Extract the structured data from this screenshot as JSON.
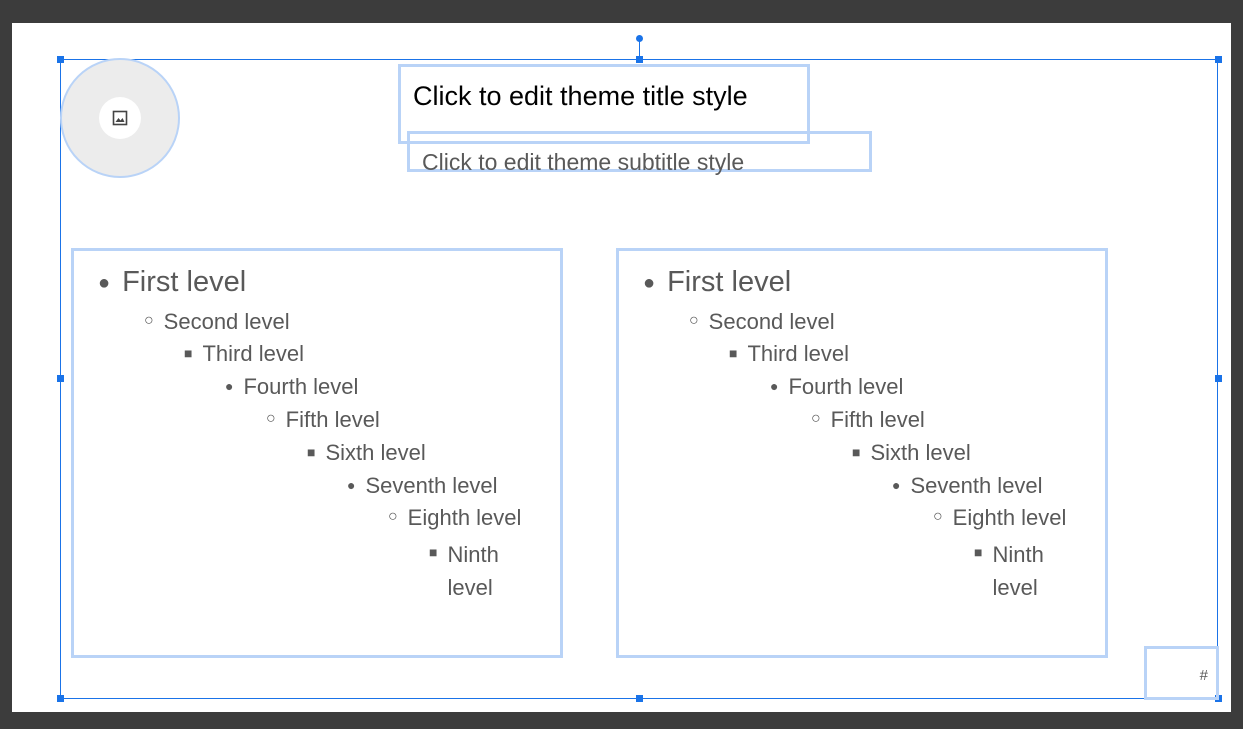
{
  "slide": {
    "title": "Click to edit theme title style",
    "subtitle": "Click to edit theme subtitle style",
    "image_icon": "image-icon",
    "slide_number": "#",
    "body_left": {
      "levels": [
        {
          "bullet": "●",
          "text": "First level"
        },
        {
          "bullet": "○",
          "text": "Second level"
        },
        {
          "bullet": "■",
          "text": "Third level"
        },
        {
          "bullet": "●",
          "text": "Fourth level"
        },
        {
          "bullet": "○",
          "text": "Fifth level"
        },
        {
          "bullet": "■",
          "text": "Sixth level"
        },
        {
          "bullet": "●",
          "text": "Seventh level"
        },
        {
          "bullet": "○",
          "text": "Eighth level"
        },
        {
          "bullet": "■",
          "text": "Ninth level"
        }
      ]
    },
    "body_right": {
      "levels": [
        {
          "bullet": "●",
          "text": "First level"
        },
        {
          "bullet": "○",
          "text": "Second level"
        },
        {
          "bullet": "■",
          "text": "Third level"
        },
        {
          "bullet": "●",
          "text": "Fourth level"
        },
        {
          "bullet": "○",
          "text": "Fifth level"
        },
        {
          "bullet": "■",
          "text": "Sixth level"
        },
        {
          "bullet": "●",
          "text": "Seventh level"
        },
        {
          "bullet": "○",
          "text": "Eighth level"
        },
        {
          "bullet": "■",
          "text": "Ninth level"
        }
      ]
    }
  },
  "colors": {
    "selection": "#1a73e8",
    "placeholder_border": "#b9d3f7",
    "canvas_background": "#3c3c3c",
    "text_gray": "#595959"
  }
}
